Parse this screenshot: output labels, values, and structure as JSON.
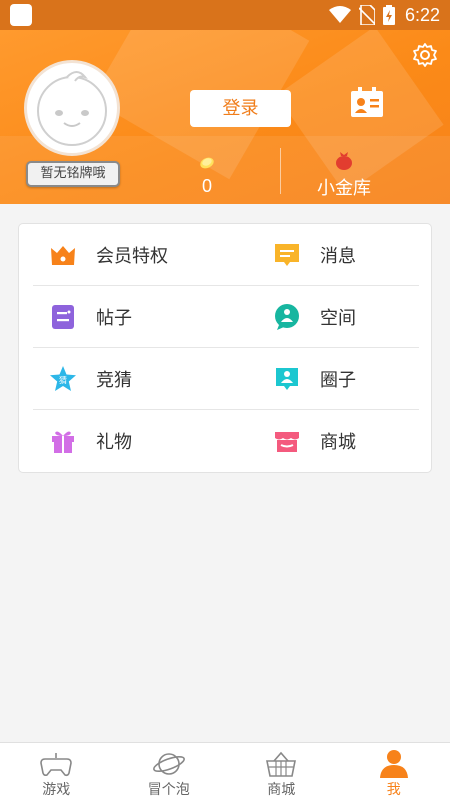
{
  "status_bar": {
    "time": "6:22"
  },
  "profile": {
    "badge": "暂无铭牌哦",
    "login_label": "登录",
    "coins": "0",
    "vault_label": "小金库"
  },
  "menu": {
    "rows": [
      [
        {
          "label": "会员特权",
          "icon": "crown-icon",
          "color": "#f7821a"
        },
        {
          "label": "消息",
          "icon": "message-icon",
          "color": "#f9b429"
        }
      ],
      [
        {
          "label": "帖子",
          "icon": "post-icon",
          "color": "#8e63dc"
        },
        {
          "label": "空间",
          "icon": "space-icon",
          "color": "#17b6a0"
        }
      ],
      [
        {
          "label": "竞猜",
          "icon": "guess-star-icon",
          "color": "#2db7e8"
        },
        {
          "label": "圈子",
          "icon": "circle-icon",
          "color": "#1cc7d0"
        }
      ],
      [
        {
          "label": "礼物",
          "icon": "gift-icon",
          "color": "#d26ee6"
        },
        {
          "label": "商城",
          "icon": "shop-icon",
          "color": "#f45a7e"
        }
      ]
    ]
  },
  "bottom_nav": {
    "items": [
      {
        "label": "游戏",
        "icon": "gamepad-icon"
      },
      {
        "label": "冒个泡",
        "icon": "planet-icon"
      },
      {
        "label": "商城",
        "icon": "basket-icon"
      },
      {
        "label": "我",
        "icon": "person-icon"
      }
    ],
    "active_index": 3,
    "active_color": "#f7821a"
  }
}
